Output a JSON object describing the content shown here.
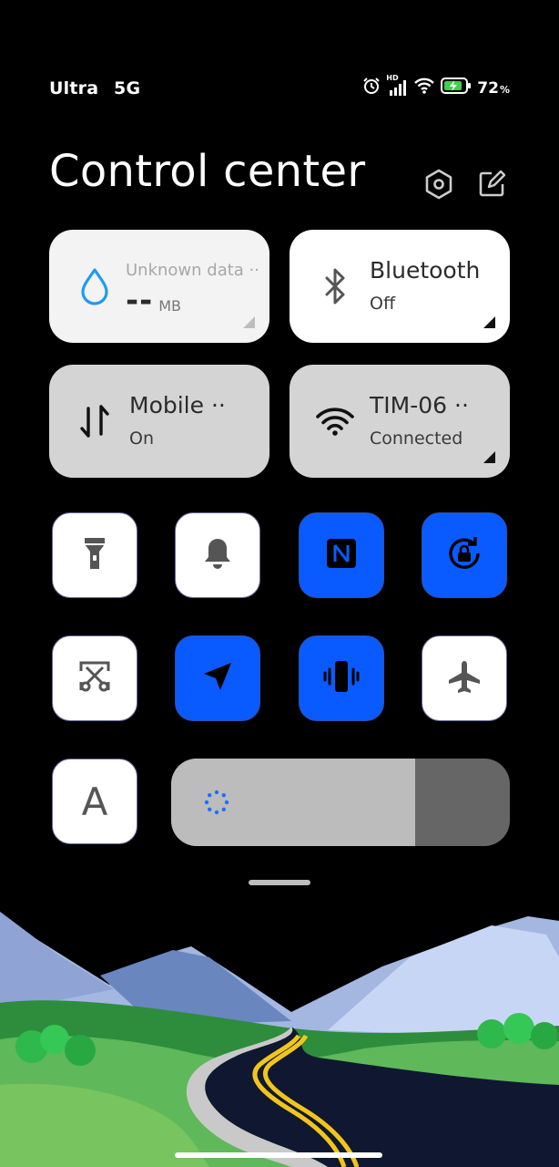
{
  "status_bar": {
    "carrier": "Ultra",
    "network": "5G",
    "signal_badge": "HD",
    "battery_level": "72",
    "battery_unit": "%",
    "icons": [
      "alarm-icon",
      "signal-icon",
      "wifi-icon",
      "battery-charging-icon"
    ]
  },
  "header": {
    "title": "Control center",
    "icons": [
      "settings-hexagon-icon",
      "edit-icon"
    ]
  },
  "tiles": {
    "data": {
      "title": "Unknown data ··",
      "value": "--",
      "unit": "MB",
      "icon": "water-drop-icon"
    },
    "bluetooth": {
      "title": "Bluetooth",
      "status": "Off",
      "icon": "bluetooth-icon"
    },
    "mobile": {
      "title": "Mobile ··",
      "status": "On",
      "icon": "mobile-data-arrows-icon"
    },
    "wifi": {
      "title": "TIM-06 ··",
      "status": "Connected",
      "icon": "wifi-icon"
    }
  },
  "toggles": [
    {
      "name": "flashlight",
      "active": false
    },
    {
      "name": "silent-bell",
      "active": false
    },
    {
      "name": "nfc",
      "active": true
    },
    {
      "name": "rotation-lock",
      "active": true
    },
    {
      "name": "screenshot-scissors",
      "active": false
    },
    {
      "name": "location",
      "active": true
    },
    {
      "name": "vibrate",
      "active": true
    },
    {
      "name": "airplane-mode",
      "active": false
    }
  ],
  "font_toggle": {
    "label": "A"
  },
  "brightness": {
    "level_percent": 72
  },
  "colors": {
    "accent": "#0a5bff",
    "tile_light": "#f3f3f3",
    "tile_grey": "#d4d4d4",
    "slider_fill": "#bcbcbc",
    "slider_track": "#666666"
  }
}
